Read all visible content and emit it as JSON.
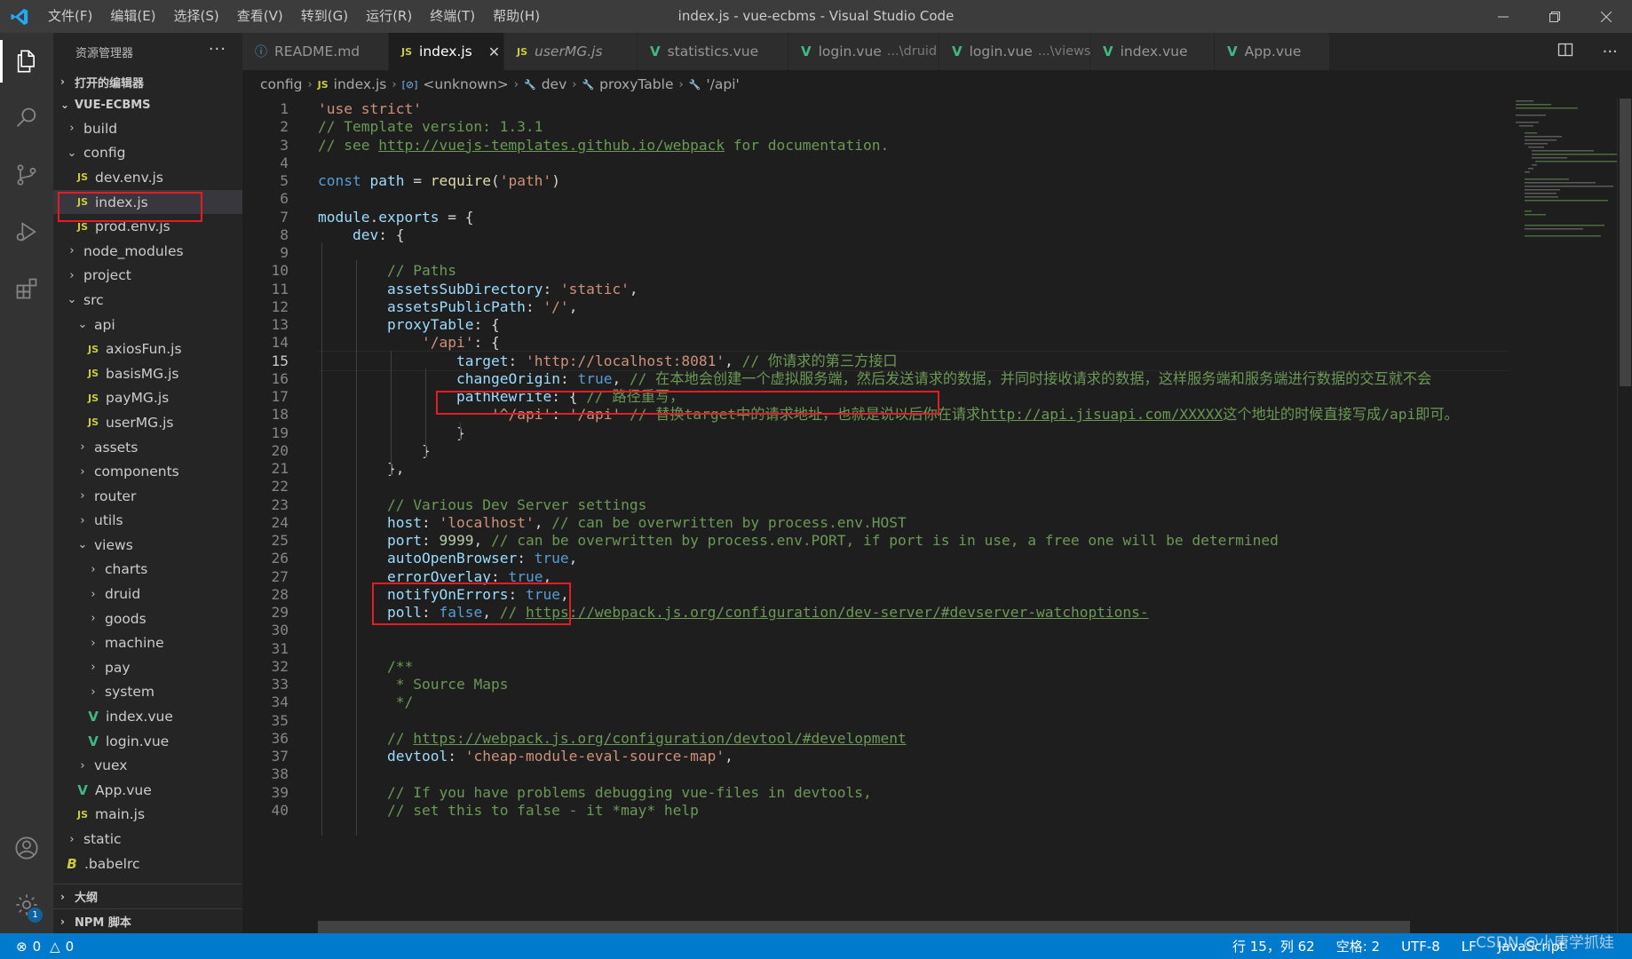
{
  "window": {
    "title": "index.js - vue-ecbms - Visual Studio Code",
    "menu": [
      "文件(F)",
      "编辑(E)",
      "选择(S)",
      "查看(V)",
      "转到(G)",
      "运行(R)",
      "终端(T)",
      "帮助(H)"
    ]
  },
  "sidebar": {
    "title": "资源管理器",
    "more": "···",
    "open_editors": "打开的编辑器",
    "root": "VUE-ECBMS",
    "tree": [
      {
        "label": "build",
        "type": "folder",
        "open": false,
        "depth": 1
      },
      {
        "label": "config",
        "type": "folder",
        "open": true,
        "depth": 1
      },
      {
        "label": "dev.env.js",
        "type": "js",
        "depth": 2
      },
      {
        "label": "index.js",
        "type": "js",
        "depth": 2,
        "selected": true
      },
      {
        "label": "prod.env.js",
        "type": "js",
        "depth": 2
      },
      {
        "label": "node_modules",
        "type": "folder",
        "open": false,
        "depth": 1
      },
      {
        "label": "project",
        "type": "folder",
        "open": false,
        "depth": 1
      },
      {
        "label": "src",
        "type": "folder",
        "open": true,
        "depth": 1
      },
      {
        "label": "api",
        "type": "folder",
        "open": true,
        "depth": 2
      },
      {
        "label": "axiosFun.js",
        "type": "js",
        "depth": 3
      },
      {
        "label": "basisMG.js",
        "type": "js",
        "depth": 3
      },
      {
        "label": "payMG.js",
        "type": "js",
        "depth": 3
      },
      {
        "label": "userMG.js",
        "type": "js",
        "depth": 3
      },
      {
        "label": "assets",
        "type": "folder",
        "open": false,
        "depth": 2
      },
      {
        "label": "components",
        "type": "folder",
        "open": false,
        "depth": 2
      },
      {
        "label": "router",
        "type": "folder",
        "open": false,
        "depth": 2
      },
      {
        "label": "utils",
        "type": "folder",
        "open": false,
        "depth": 2
      },
      {
        "label": "views",
        "type": "folder",
        "open": true,
        "depth": 2
      },
      {
        "label": "charts",
        "type": "folder",
        "open": false,
        "depth": 3
      },
      {
        "label": "druid",
        "type": "folder",
        "open": false,
        "depth": 3
      },
      {
        "label": "goods",
        "type": "folder",
        "open": false,
        "depth": 3
      },
      {
        "label": "machine",
        "type": "folder",
        "open": false,
        "depth": 3
      },
      {
        "label": "pay",
        "type": "folder",
        "open": false,
        "depth": 3
      },
      {
        "label": "system",
        "type": "folder",
        "open": false,
        "depth": 3
      },
      {
        "label": "index.vue",
        "type": "vue",
        "depth": 3
      },
      {
        "label": "login.vue",
        "type": "vue",
        "depth": 3
      },
      {
        "label": "vuex",
        "type": "folder",
        "open": false,
        "depth": 2
      },
      {
        "label": "App.vue",
        "type": "vue",
        "depth": 2
      },
      {
        "label": "main.js",
        "type": "js",
        "depth": 2
      },
      {
        "label": "static",
        "type": "folder",
        "open": false,
        "depth": 1
      },
      {
        "label": ".babelrc",
        "type": "babel",
        "depth": 1
      }
    ],
    "outline": "大纲",
    "npm": "NPM 脚本"
  },
  "tabs": [
    {
      "label": "README.md",
      "icon": "md",
      "desc": "",
      "active": false,
      "italic": false
    },
    {
      "label": "index.js",
      "icon": "js",
      "desc": "",
      "active": true,
      "italic": false,
      "close": "✕"
    },
    {
      "label": "userMG.js",
      "icon": "js",
      "desc": "",
      "active": false,
      "italic": true
    },
    {
      "label": "statistics.vue",
      "icon": "vue",
      "desc": "",
      "active": false,
      "italic": false
    },
    {
      "label": "login.vue",
      "icon": "vue",
      "desc": "...\\druid",
      "active": false,
      "italic": false
    },
    {
      "label": "login.vue",
      "icon": "vue",
      "desc": "...\\views",
      "active": false,
      "italic": false
    },
    {
      "label": "index.vue",
      "icon": "vue",
      "desc": "",
      "active": false,
      "italic": false
    },
    {
      "label": "App.vue",
      "icon": "vue",
      "desc": "",
      "active": false,
      "italic": false
    }
  ],
  "breadcrumb": [
    {
      "label": "config",
      "icon": ""
    },
    {
      "label": "index.js",
      "icon": "JS"
    },
    {
      "label": "<unknown>",
      "icon": "[⊘]"
    },
    {
      "label": "dev",
      "icon": "🔧"
    },
    {
      "label": "proxyTable",
      "icon": "🔧"
    },
    {
      "label": "'/api'",
      "icon": "🔧"
    }
  ],
  "editor": {
    "current_line": 15,
    "lines": [
      {
        "n": "1",
        "indent": 0,
        "tokens": [
          [
            "str",
            "'use strict'"
          ]
        ]
      },
      {
        "n": "2",
        "indent": 0,
        "tokens": [
          [
            "com",
            "// Template version: 1.3.1"
          ]
        ]
      },
      {
        "n": "3",
        "indent": 0,
        "tokens": [
          [
            "com",
            "// see "
          ],
          [
            "link",
            "http://vuejs-templates.github.io/webpack"
          ],
          [
            "com",
            " for documentation."
          ]
        ]
      },
      {
        "n": "4",
        "indent": 0,
        "tokens": []
      },
      {
        "n": "5",
        "indent": 0,
        "tokens": [
          [
            "kw",
            "const"
          ],
          [
            "plain",
            " "
          ],
          [
            "prop",
            "path"
          ],
          [
            "plain",
            " = "
          ],
          [
            "fn",
            "require"
          ],
          [
            "plain",
            "("
          ],
          [
            "str",
            "'path'"
          ],
          [
            "plain",
            ")"
          ]
        ]
      },
      {
        "n": "6",
        "indent": 0,
        "tokens": []
      },
      {
        "n": "7",
        "indent": 0,
        "tokens": [
          [
            "prop",
            "module"
          ],
          [
            "plain",
            "."
          ],
          [
            "prop",
            "exports"
          ],
          [
            "plain",
            " = {"
          ]
        ]
      },
      {
        "n": "8",
        "indent": 1,
        "tokens": [
          [
            "prop",
            "dev"
          ],
          [
            "plain",
            ": {"
          ]
        ]
      },
      {
        "n": "9",
        "indent": 0,
        "tokens": []
      },
      {
        "n": "10",
        "indent": 2,
        "tokens": [
          [
            "com",
            "// Paths"
          ]
        ]
      },
      {
        "n": "11",
        "indent": 2,
        "tokens": [
          [
            "prop",
            "assetsSubDirectory"
          ],
          [
            "plain",
            ": "
          ],
          [
            "str",
            "'static'"
          ],
          [
            "plain",
            ","
          ]
        ]
      },
      {
        "n": "12",
        "indent": 2,
        "tokens": [
          [
            "prop",
            "assetsPublicPath"
          ],
          [
            "plain",
            ": "
          ],
          [
            "str",
            "'/'"
          ],
          [
            "plain",
            ","
          ]
        ]
      },
      {
        "n": "13",
        "indent": 2,
        "tokens": [
          [
            "prop",
            "proxyTable"
          ],
          [
            "plain",
            ": {"
          ]
        ]
      },
      {
        "n": "14",
        "indent": 3,
        "tokens": [
          [
            "str",
            "'/api'"
          ],
          [
            "plain",
            ": {"
          ]
        ]
      },
      {
        "n": "15",
        "indent": 4,
        "tokens": [
          [
            "prop",
            "target"
          ],
          [
            "plain",
            ": "
          ],
          [
            "str",
            "'http://localhost:8081'"
          ],
          [
            "plain",
            ", "
          ],
          [
            "com",
            "// 你请求的第三方接口"
          ]
        ]
      },
      {
        "n": "16",
        "indent": 4,
        "tokens": [
          [
            "prop",
            "changeOrigin"
          ],
          [
            "plain",
            ": "
          ],
          [
            "kw",
            "true"
          ],
          [
            "plain",
            ", "
          ],
          [
            "com",
            "// 在本地会创建一个虚拟服务端，然后发送请求的数据，并同时接收请求的数据，这样服务端和服务端进行数据的交互就不会"
          ]
        ]
      },
      {
        "n": "17",
        "indent": 4,
        "tokens": [
          [
            "prop",
            "pathRewrite"
          ],
          [
            "plain",
            ": { "
          ],
          [
            "com",
            "// 路径重写，"
          ]
        ]
      },
      {
        "n": "18",
        "indent": 5,
        "tokens": [
          [
            "str",
            "'^/api'"
          ],
          [
            "plain",
            ": "
          ],
          [
            "str",
            "'/api'"
          ],
          [
            "plain",
            " "
          ],
          [
            "com",
            "// 替换target中的请求地址，也就是说以后你在请求"
          ],
          [
            "link",
            "http://api.jisuapi.com/XXXXX"
          ],
          [
            "com",
            "这个地址的时候直接写成/api即可。"
          ]
        ]
      },
      {
        "n": "19",
        "indent": 4,
        "tokens": [
          [
            "plain",
            "}"
          ]
        ]
      },
      {
        "n": "20",
        "indent": 3,
        "tokens": [
          [
            "plain",
            "}"
          ]
        ]
      },
      {
        "n": "21",
        "indent": 2,
        "tokens": [
          [
            "plain",
            "},"
          ]
        ]
      },
      {
        "n": "22",
        "indent": 0,
        "tokens": []
      },
      {
        "n": "23",
        "indent": 2,
        "tokens": [
          [
            "com",
            "// Various Dev Server settings"
          ]
        ]
      },
      {
        "n": "24",
        "indent": 2,
        "tokens": [
          [
            "prop",
            "host"
          ],
          [
            "plain",
            ": "
          ],
          [
            "str",
            "'localhost'"
          ],
          [
            "plain",
            ", "
          ],
          [
            "com",
            "// can be overwritten by process.env.HOST"
          ]
        ]
      },
      {
        "n": "25",
        "indent": 2,
        "tokens": [
          [
            "prop",
            "port"
          ],
          [
            "plain",
            ": "
          ],
          [
            "num",
            "9999"
          ],
          [
            "plain",
            ", "
          ],
          [
            "com",
            "// can be overwritten by process.env.PORT, if port is in use, a free one will be determined"
          ]
        ]
      },
      {
        "n": "26",
        "indent": 2,
        "tokens": [
          [
            "prop",
            "autoOpenBrowser"
          ],
          [
            "plain",
            ": "
          ],
          [
            "kw",
            "true"
          ],
          [
            "plain",
            ","
          ]
        ]
      },
      {
        "n": "27",
        "indent": 2,
        "tokens": [
          [
            "prop",
            "errorOverlay"
          ],
          [
            "plain",
            ": "
          ],
          [
            "kw",
            "true"
          ],
          [
            "plain",
            ","
          ]
        ]
      },
      {
        "n": "28",
        "indent": 2,
        "tokens": [
          [
            "prop",
            "notifyOnErrors"
          ],
          [
            "plain",
            ": "
          ],
          [
            "kw",
            "true"
          ],
          [
            "plain",
            ","
          ]
        ]
      },
      {
        "n": "29",
        "indent": 2,
        "tokens": [
          [
            "prop",
            "poll"
          ],
          [
            "plain",
            ": "
          ],
          [
            "kw",
            "false"
          ],
          [
            "plain",
            ", "
          ],
          [
            "com",
            "// "
          ],
          [
            "link",
            "https://webpack.js.org/configuration/dev-server/#devserver-watchoptions-"
          ]
        ]
      },
      {
        "n": "30",
        "indent": 0,
        "tokens": []
      },
      {
        "n": "31",
        "indent": 0,
        "tokens": []
      },
      {
        "n": "32",
        "indent": 2,
        "tokens": [
          [
            "com",
            "/**"
          ]
        ]
      },
      {
        "n": "33",
        "indent": 2,
        "tokens": [
          [
            "com",
            " * Source Maps"
          ]
        ]
      },
      {
        "n": "34",
        "indent": 2,
        "tokens": [
          [
            "com",
            " */"
          ]
        ]
      },
      {
        "n": "35",
        "indent": 0,
        "tokens": []
      },
      {
        "n": "36",
        "indent": 2,
        "tokens": [
          [
            "com",
            "// "
          ],
          [
            "link",
            "https://webpack.js.org/configuration/devtool/#development"
          ]
        ]
      },
      {
        "n": "37",
        "indent": 2,
        "tokens": [
          [
            "prop",
            "devtool"
          ],
          [
            "plain",
            ": "
          ],
          [
            "str",
            "'cheap-module-eval-source-map'"
          ],
          [
            "plain",
            ","
          ]
        ]
      },
      {
        "n": "38",
        "indent": 0,
        "tokens": []
      },
      {
        "n": "39",
        "indent": 2,
        "tokens": [
          [
            "com",
            "// If you have problems debugging vue-files in devtools,"
          ]
        ]
      },
      {
        "n": "40",
        "indent": 2,
        "tokens": [
          [
            "com",
            "// set this to false - it *may* help"
          ]
        ]
      }
    ]
  },
  "statusbar": {
    "errors": "0",
    "warnings": "0",
    "position": "行 15，列 62",
    "spaces": "空格: 2",
    "encoding": "UTF-8",
    "eol": "LF",
    "language": "JavaScript",
    "notifications_badge": "1"
  },
  "watermark": "CSDN @小唐学抓娃",
  "colors": {
    "accent": "#007acc",
    "highlight_box": "#e51c23"
  }
}
